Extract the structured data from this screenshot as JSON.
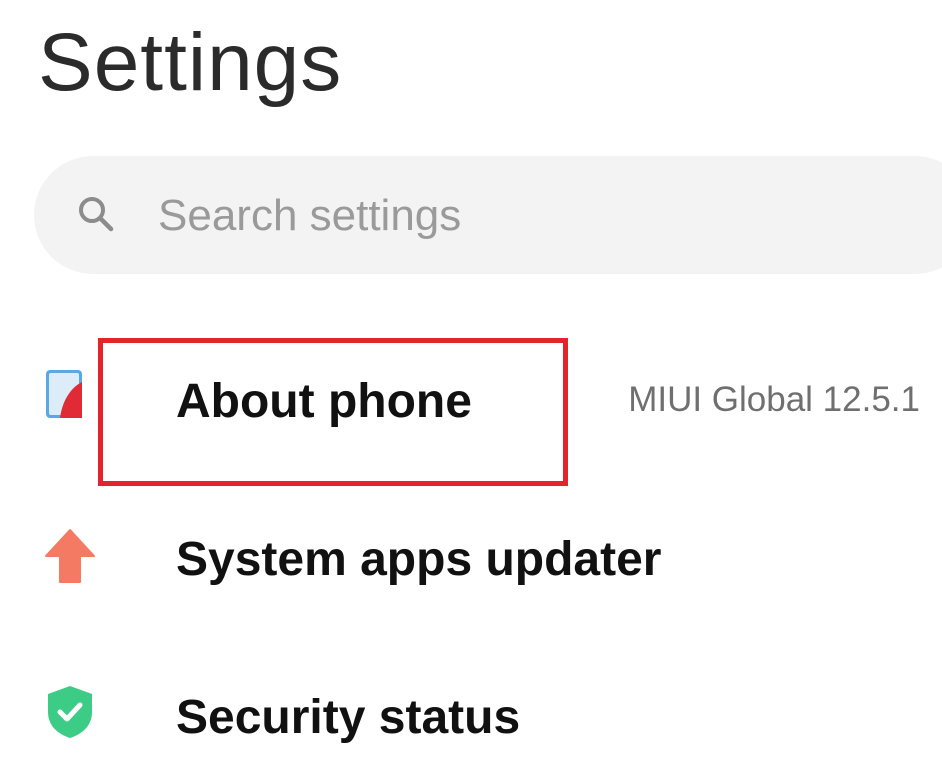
{
  "header": {
    "title": "Settings"
  },
  "search": {
    "icon": "search-icon",
    "placeholder": "Search settings",
    "value": ""
  },
  "settings_items": [
    {
      "label": "About phone",
      "value": "MIUI Global 12.5.1",
      "icon": "phone-info-icon",
      "icon_color": "#e02b36",
      "highlighted": true
    },
    {
      "label": "System apps updater",
      "value": "",
      "icon": "arrow-up-icon",
      "icon_color": "#f57a63"
    },
    {
      "label": "Security status",
      "value": "",
      "icon": "shield-check-icon",
      "icon_color": "#3ccc86"
    }
  ],
  "colors": {
    "highlight_border": "#e3242b",
    "search_background": "#f3f3f3"
  }
}
